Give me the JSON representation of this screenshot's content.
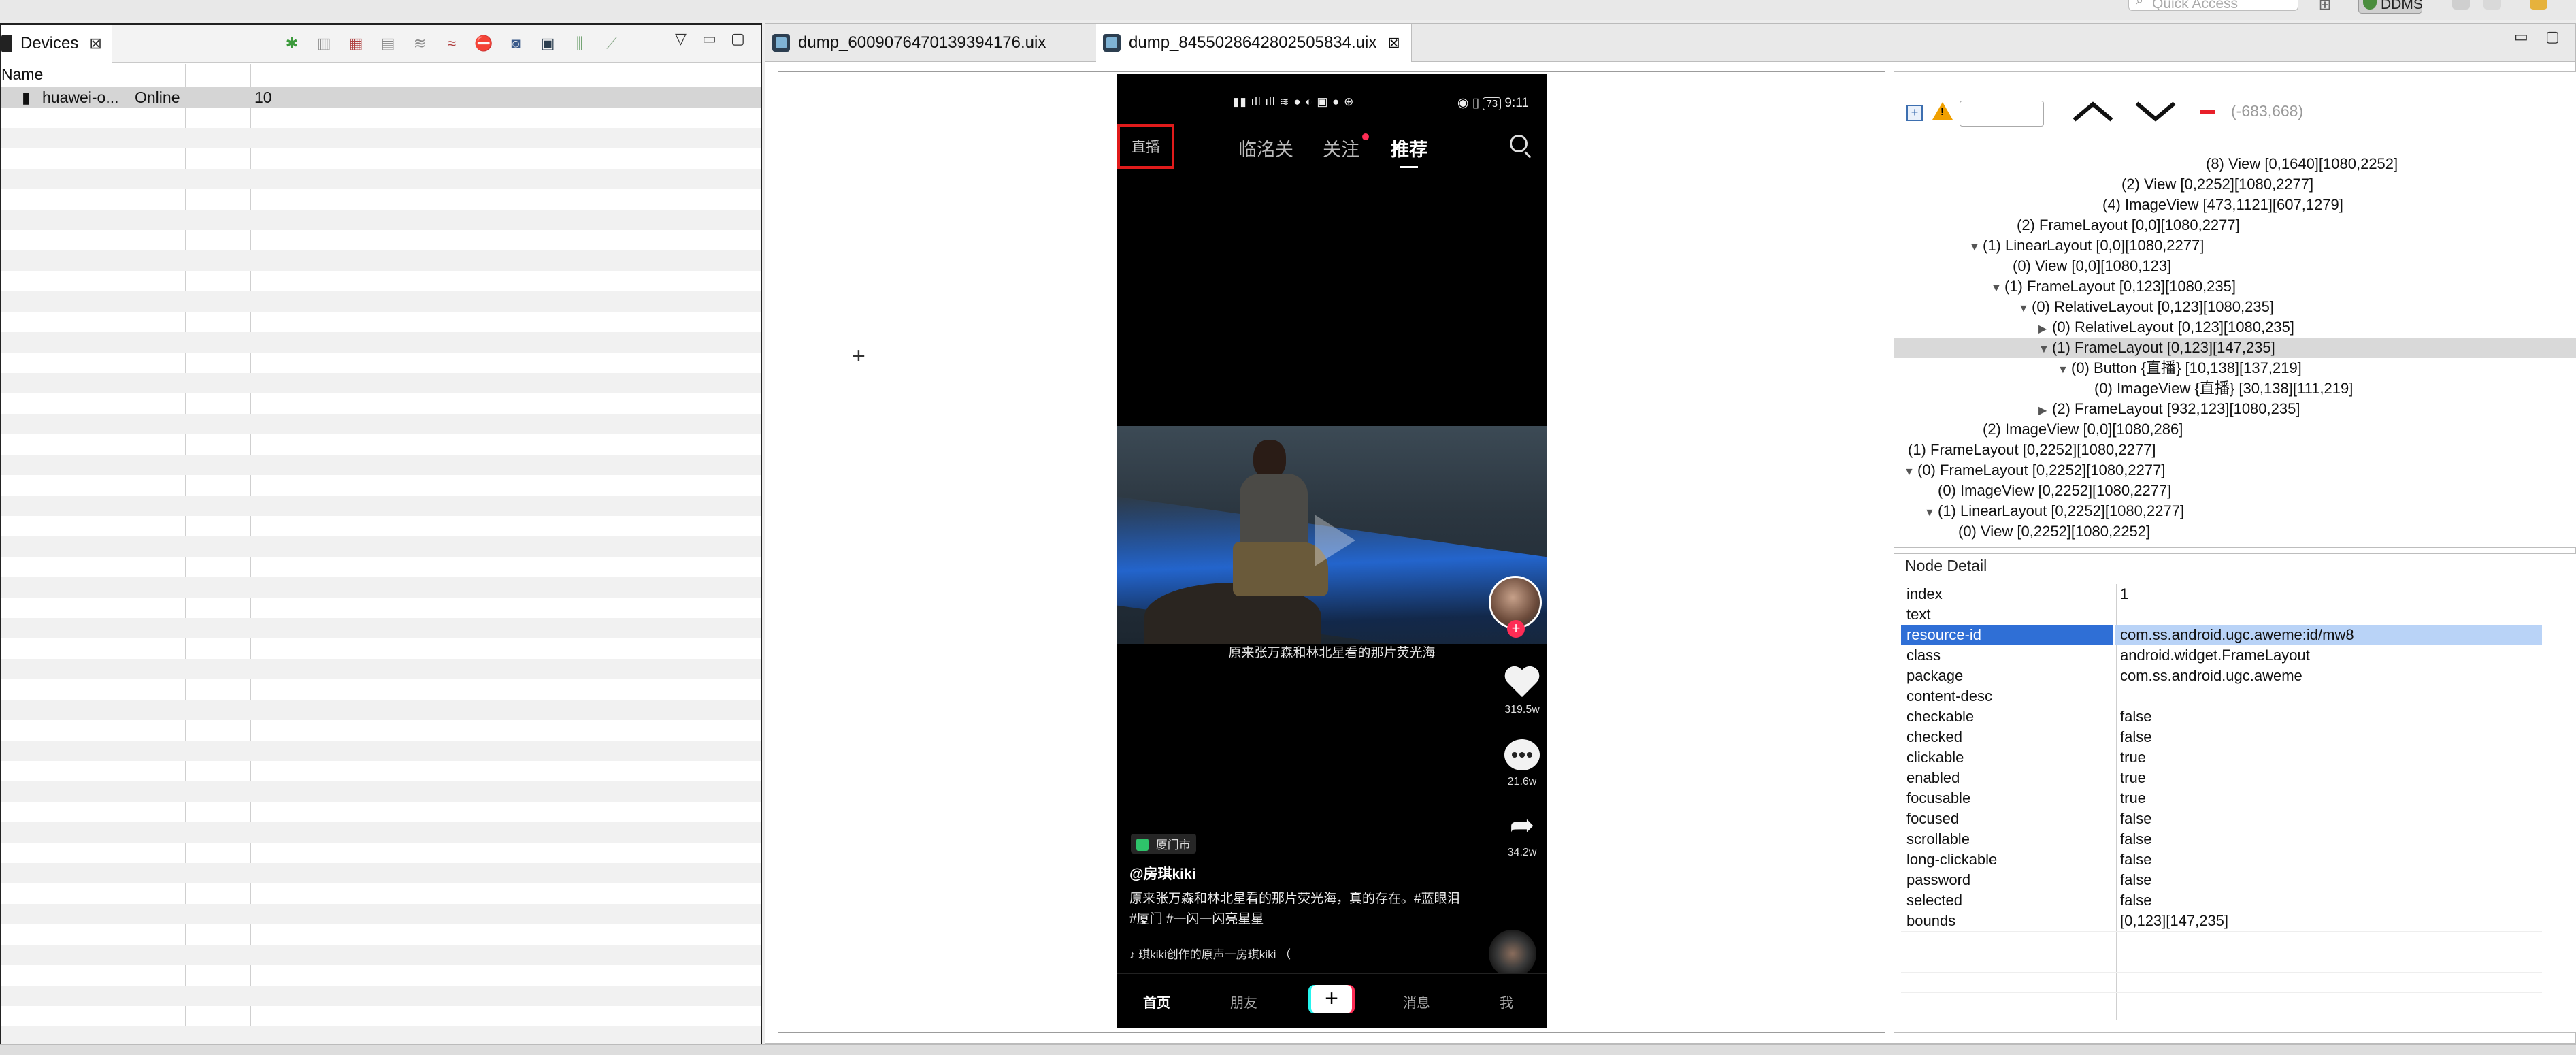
{
  "topbar": {
    "quick_access_placeholder": "Quick Access",
    "perspective_label": "DDMS"
  },
  "devices_view": {
    "tab_title": "Devices",
    "column_name": "Name",
    "device": {
      "name": "huawei-o...",
      "status": "Online",
      "api": "10"
    },
    "toolbar_icons": [
      "debug-icon",
      "update-heap-icon",
      "dump-hprof-icon",
      "cause-gc-icon",
      "update-threads-icon",
      "start-method-profiling-icon",
      "stop-process-icon",
      "screen-capture-icon",
      "dump-view-hierarchy-icon",
      "systrace-icon",
      "opengl-trace-icon"
    ]
  },
  "editor": {
    "tabs": [
      {
        "label": "dump_6009076470139394176.uix"
      },
      {
        "label": "dump_8455028642802505834.uix"
      }
    ]
  },
  "phone": {
    "status_time": "9:11",
    "status_battery": "73",
    "live_button_label": "直播",
    "nav_tabs": [
      "临洺关",
      "关注",
      "推荐"
    ],
    "video_caption": "原来张万森和林北星看的那片荧光海",
    "like_count": "319.5w",
    "comment_count": "21.6w",
    "share_count": "34.2w",
    "location": "厦门市",
    "author": "@房琪kiki",
    "description": "原来张万森和林北星看的那片荧光海，真的存在。#蓝眼泪 #厦门 #一闪一闪亮星星",
    "music": "琪kiki创作的原声一房琪kiki （",
    "bottom_nav": [
      "首页",
      "朋友",
      "+",
      "消息",
      "我"
    ]
  },
  "hierarchy": {
    "coords_readout": "(-683,668)",
    "nodes": [
      {
        "text": "(8) View [0,1640][1080,2252]",
        "toggle": ""
      },
      {
        "text": "(2) View [0,2252][1080,2277]",
        "toggle": ""
      },
      {
        "text": "(4) ImageView [473,1121][607,1279]",
        "toggle": ""
      },
      {
        "text": "(2) FrameLayout [0,0][1080,2277]",
        "toggle": ""
      },
      {
        "text": "(1) LinearLayout [0,0][1080,2277]",
        "toggle": "▼"
      },
      {
        "text": "(0) View [0,0][1080,123]",
        "toggle": ""
      },
      {
        "text": "(1) FrameLayout [0,123][1080,235]",
        "toggle": "▼"
      },
      {
        "text": "(0) RelativeLayout [0,123][1080,235]",
        "toggle": "▼"
      },
      {
        "text": "(0) RelativeLayout [0,123][1080,235]",
        "toggle": "▶"
      },
      {
        "text": "(1) FrameLayout [0,123][147,235]",
        "toggle": "▼"
      },
      {
        "text": "(0) Button {直播} [10,138][137,219]",
        "toggle": "▼"
      },
      {
        "text": "(0) ImageView {直播} [30,138][111,219]",
        "toggle": ""
      },
      {
        "text": "(2) FrameLayout [932,123][1080,235]",
        "toggle": "▶"
      },
      {
        "text": "(2) ImageView [0,0][1080,286]",
        "toggle": ""
      },
      {
        "text": "(1) FrameLayout [0,2252][1080,2277]",
        "toggle": ""
      },
      {
        "text": "(0) FrameLayout [0,2252][1080,2277]",
        "toggle": "▼"
      },
      {
        "text": "(0) ImageView [0,2252][1080,2277]",
        "toggle": ""
      },
      {
        "text": "(1) LinearLayout [0,2252][1080,2277]",
        "toggle": "▼"
      },
      {
        "text": "(0) View [0,2252][1080,2252]",
        "toggle": ""
      }
    ]
  },
  "node_detail": {
    "title": "Node Detail",
    "rows": [
      {
        "key": "index",
        "value": "1"
      },
      {
        "key": "text",
        "value": ""
      },
      {
        "key": "resource-id",
        "value": "com.ss.android.ugc.aweme:id/mw8"
      },
      {
        "key": "class",
        "value": "android.widget.FrameLayout"
      },
      {
        "key": "package",
        "value": "com.ss.android.ugc.aweme"
      },
      {
        "key": "content-desc",
        "value": ""
      },
      {
        "key": "checkable",
        "value": "false"
      },
      {
        "key": "checked",
        "value": "false"
      },
      {
        "key": "clickable",
        "value": "true"
      },
      {
        "key": "enabled",
        "value": "true"
      },
      {
        "key": "focusable",
        "value": "true"
      },
      {
        "key": "focused",
        "value": "false"
      },
      {
        "key": "scrollable",
        "value": "false"
      },
      {
        "key": "long-clickable",
        "value": "false"
      },
      {
        "key": "password",
        "value": "false"
      },
      {
        "key": "selected",
        "value": "false"
      },
      {
        "key": "bounds",
        "value": "[0,123][147,235]"
      }
    ]
  }
}
